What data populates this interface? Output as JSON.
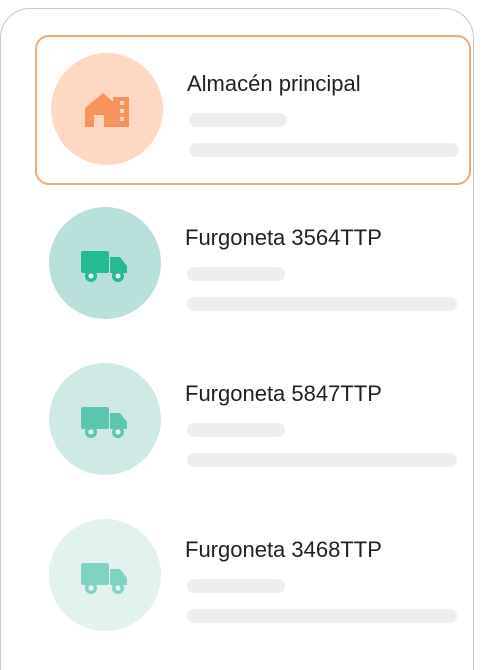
{
  "list": {
    "items": [
      {
        "label": "Almacén principal",
        "icon": "warehouse-icon",
        "selected": true,
        "circle_color": "#fdd9c4",
        "icon_color": "#f6945c",
        "border_color": "#f0a878"
      },
      {
        "label": "Furgoneta 3564TTP",
        "icon": "truck-icon",
        "selected": false,
        "circle_color": "#b9e0da",
        "icon_color": "#27b894"
      },
      {
        "label": "Furgoneta 5847TTP",
        "icon": "truck-icon",
        "selected": false,
        "circle_color": "#cfe9e4",
        "icon_color": "#5cc6ae"
      },
      {
        "label": "Furgoneta 3468TTP",
        "icon": "truck-icon",
        "selected": false,
        "circle_color": "#e2f2ef",
        "icon_color": "#7fd3c0"
      }
    ]
  }
}
